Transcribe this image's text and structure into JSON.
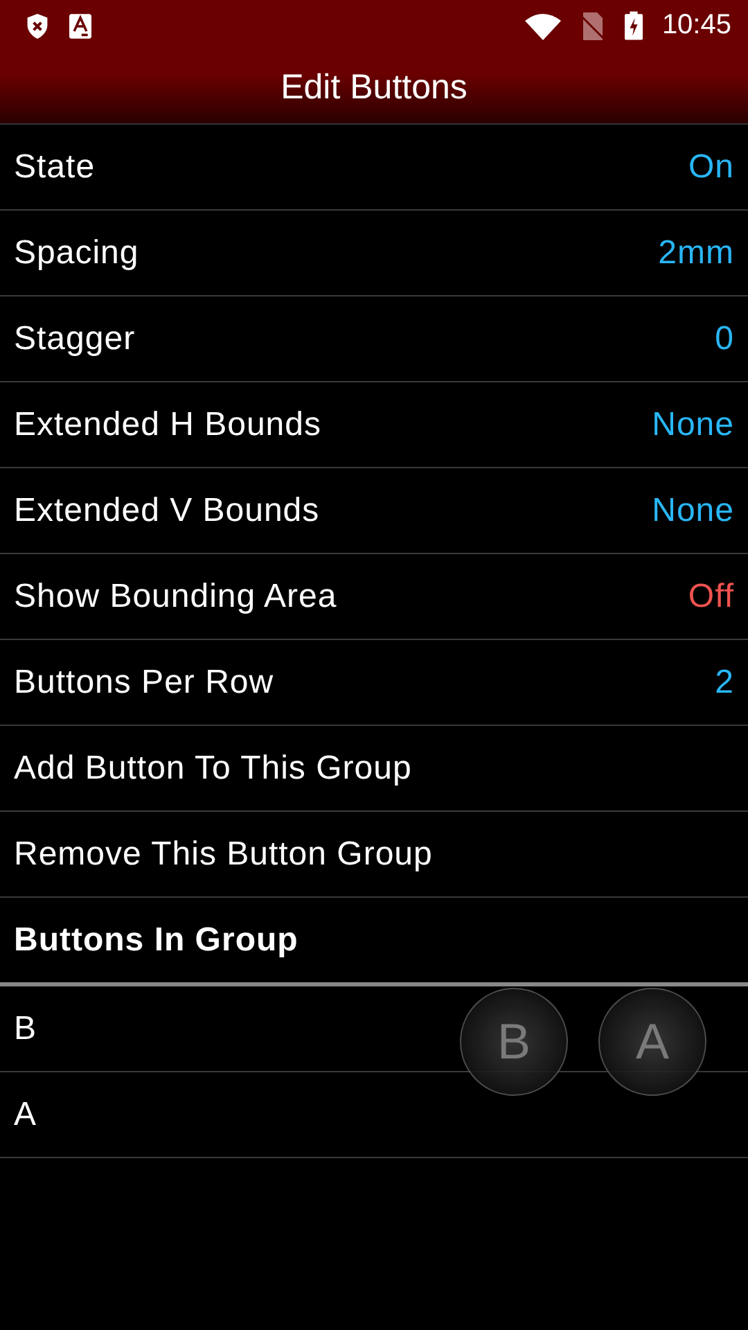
{
  "status_bar": {
    "time": "10:45"
  },
  "title": "Edit Buttons",
  "settings": [
    {
      "kind": "value",
      "label": "State",
      "value": "On",
      "color": "#29b6f6"
    },
    {
      "kind": "value",
      "label": "Spacing",
      "value": "2mm",
      "color": "#29b6f6"
    },
    {
      "kind": "value",
      "label": "Stagger",
      "value": "0",
      "color": "#29b6f6"
    },
    {
      "kind": "value",
      "label": "Extended H Bounds",
      "value": "None",
      "color": "#29b6f6"
    },
    {
      "kind": "value",
      "label": "Extended V Bounds",
      "value": "None",
      "color": "#29b6f6"
    },
    {
      "kind": "value",
      "label": "Show Bounding Area",
      "value": "Off",
      "color": "#ef5350"
    },
    {
      "kind": "value",
      "label": "Buttons Per Row",
      "value": "2",
      "color": "#29b6f6"
    },
    {
      "kind": "action",
      "label": "Add Button To This Group"
    },
    {
      "kind": "action",
      "label": "Remove This Button Group"
    },
    {
      "kind": "header",
      "label": "Buttons In Group"
    }
  ],
  "group_buttons": [
    {
      "label": "B"
    },
    {
      "label": "A"
    }
  ],
  "overlay_buttons": [
    {
      "label": "B"
    },
    {
      "label": "A"
    }
  ]
}
